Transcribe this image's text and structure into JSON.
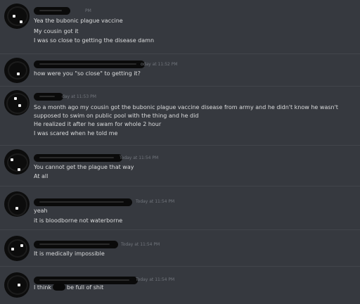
{
  "messages": [
    {
      "timestamp": "PM",
      "lines": [
        "Yea the bubonic plague vaccine",
        "My cousin got it",
        "I was so close to getting the disease damn"
      ]
    },
    {
      "timestamp": "oday at 11:52 PM",
      "lines": [
        "how were you \"so close\" to getting it?"
      ]
    },
    {
      "timestamp": "day at 11:53 PM",
      "lines": [
        "So a month ago my cousin got the bubonic plague vaccine disease from army and he didn't know he wasn't supposed to swim on public pool with the thing and he did",
        "He realized it after he swam for whole 2 hour",
        "I was scared when he told me"
      ]
    },
    {
      "timestamp": "Today at 11:54 PM",
      "lines": [
        "You cannot get the plague that way",
        "At all"
      ]
    },
    {
      "timestamp": "Today at 11:54 PM",
      "lines": [
        "yeah",
        "it is bloodborne not waterborne"
      ]
    },
    {
      "timestamp": "Today at 11:54 PM",
      "lines": [
        "It is medically impossible"
      ]
    },
    {
      "timestamp": "Today at 11:54 PM",
      "line_prefix": "I think",
      "line_suffix": "be full of shit"
    }
  ]
}
